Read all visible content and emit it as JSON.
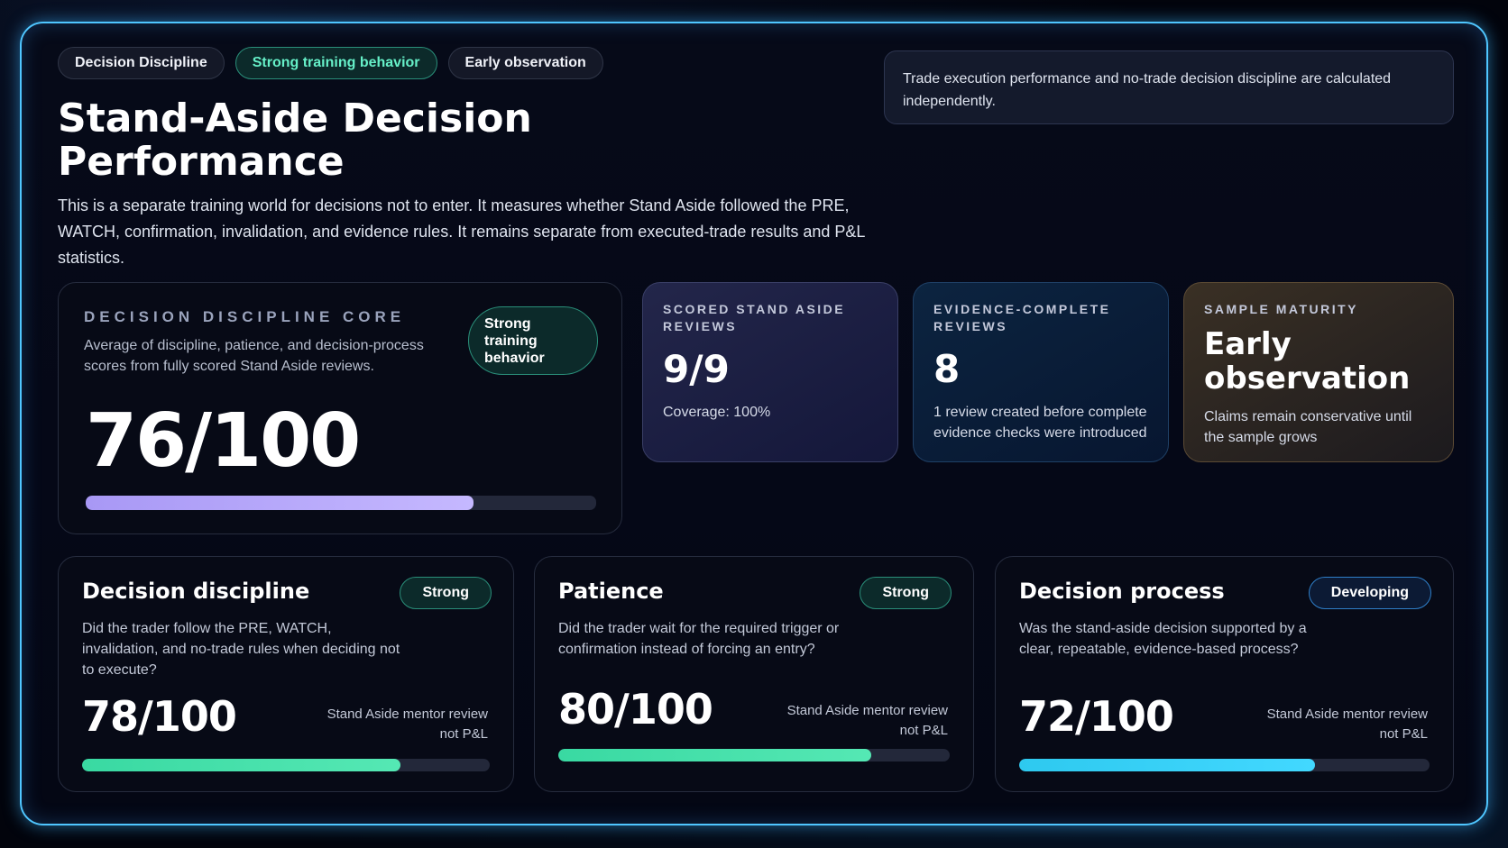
{
  "pills": [
    "Decision Discipline",
    "Strong training behavior",
    "Early observation"
  ],
  "note": "Trade execution performance and no-trade decision discipline are calculated independently.",
  "title": "Stand-Aside Decision Performance",
  "description": "This is a separate training world for decisions not to enter. It measures whether Stand Aside followed the PRE, WATCH, confirmation, invalidation, and evidence rules. It remains separate from executed-trade results and P&L statistics.",
  "core": {
    "label": "DECISION DISCIPLINE CORE",
    "sub": "Average of discipline, patience, and decision-process scores from fully scored Stand Aside reviews.",
    "badge": "Strong training behavior",
    "score": "76/100",
    "progress": 0.76,
    "bar_color": "#b5a6fa"
  },
  "stats": [
    {
      "label": "SCORED STAND ASIDE REVIEWS",
      "value": "9/9",
      "note": "Coverage: 100%"
    },
    {
      "label": "EVIDENCE-COMPLETE REVIEWS",
      "value": "8",
      "note": "1 review created before complete evidence checks were introduced"
    },
    {
      "label": "SAMPLE MATURITY",
      "value": "Early observation",
      "note": "Claims remain conservative until the sample grows"
    }
  ],
  "metrics": [
    {
      "title": "Decision discipline",
      "badge": "Strong",
      "desc": "Did the trader follow the PRE, WATCH, invalidation, and no-trade rules when deciding not to execute?",
      "score": "78/100",
      "meta": "Stand Aside mentor review not P&L",
      "progress": 0.78,
      "color": "#45e0ab"
    },
    {
      "title": "Patience",
      "badge": "Strong",
      "desc": "Did the trader wait for the required trigger or confirmation instead of forcing an entry?",
      "score": "80/100",
      "meta": "Stand Aside mentor review not P&L",
      "progress": 0.8,
      "color": "#45e0ab"
    },
    {
      "title": "Decision process",
      "badge": "Developing",
      "desc": "Was the stand-aside decision supported by a clear, repeatable, evidence-based process?",
      "score": "72/100",
      "meta": "Stand Aside mentor review not P&L",
      "progress": 0.72,
      "color": "#38d0f8"
    }
  ]
}
